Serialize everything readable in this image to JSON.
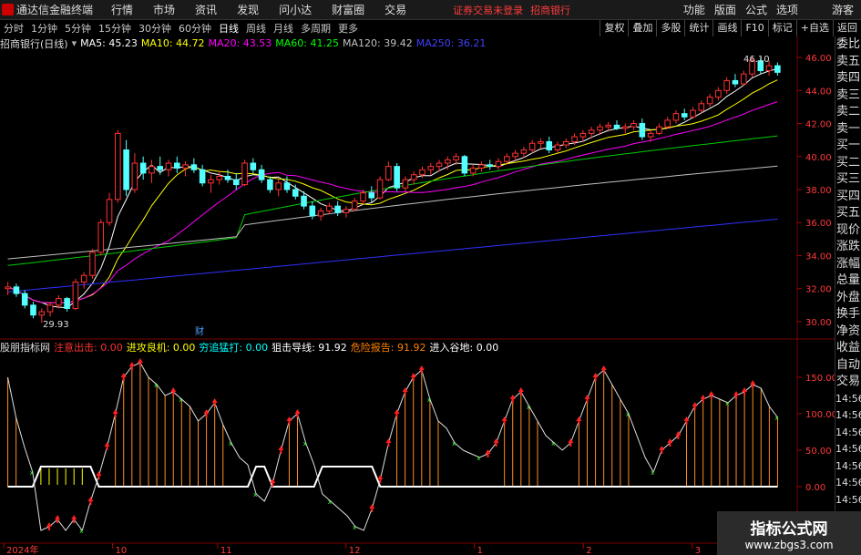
{
  "menubar": {
    "app_title": "通达信金融终端",
    "items": [
      "行情",
      "市场",
      "资讯",
      "发现",
      "问小达",
      "财富圈",
      "交易"
    ],
    "warning": "证券交易未登录",
    "broker": "招商银行",
    "right_items": [
      "功能",
      "版面",
      "公式",
      "选项"
    ],
    "guest": "游客"
  },
  "toolbar": {
    "periods": [
      "分时",
      "1分钟",
      "5分钟",
      "15分钟",
      "30分钟",
      "60分钟",
      "日线",
      "周线",
      "月线",
      "多周期",
      "更多"
    ],
    "active_period": "日线",
    "buttons": [
      "复权",
      "叠加",
      "多股",
      "统计",
      "画线",
      "F10",
      "标记",
      "+自选",
      "返回"
    ]
  },
  "stock": {
    "name": "招商银行(日线)"
  },
  "ma_legend": [
    {
      "label": "MA5: 45.23",
      "color": "#ffffff"
    },
    {
      "label": "MA10: 44.72",
      "color": "#ffff00"
    },
    {
      "label": "MA20: 43.53",
      "color": "#ff00ff"
    },
    {
      "label": "MA60: 41.25",
      "color": "#00ff00"
    },
    {
      "label": "MA120: 39.42",
      "color": "#c0c0c0"
    },
    {
      "label": "MA250: 36.21",
      "color": "#4040ff"
    }
  ],
  "indicator": {
    "name": "股朋指标网",
    "items": [
      {
        "label": "注意出击: 0.00",
        "color": "#ff3030"
      },
      {
        "label": "进攻良机: 0.00",
        "color": "#ffff00"
      },
      {
        "label": "穷追猛打: 0.00",
        "color": "#00ffff"
      },
      {
        "label": "狙击导线: 91.92",
        "color": "#ffffff"
      },
      {
        "label": "危险报告: 91.92",
        "color": "#ff8000"
      },
      {
        "label": "进入谷地: 0.00",
        "color": "#ffffff"
      }
    ]
  },
  "sidebar": [
    "委比",
    "卖五",
    "卖四",
    "卖三",
    "卖二",
    "卖一",
    "买一",
    "买二",
    "买三",
    "买四",
    "买五",
    "现价",
    "涨跌",
    "涨幅",
    "总量",
    "外盘",
    "换手",
    "净资",
    "收益",
    "自动",
    "交易",
    "14:56",
    "14:56",
    "14:56",
    "14:56",
    "14:56",
    "14:56",
    "14:56",
    "14:56"
  ],
  "price_axis": [
    "46.00",
    "44.00",
    "42.00",
    "40.00",
    "38.00",
    "36.00",
    "34.00",
    "32.00",
    "30.00"
  ],
  "ind_axis": [
    "150.00",
    "100.00",
    "50.00",
    "0.00"
  ],
  "time_axis": [
    "2024年",
    "10",
    "11",
    "12",
    "1",
    "2",
    "3"
  ],
  "annotations": {
    "high": "46.10",
    "low": "29.93",
    "cai": "财"
  },
  "watermark": {
    "line1": "指标公式网",
    "line2": "www.zbgs3.com"
  },
  "chart_data": {
    "type": "candlestick",
    "ylim": [
      29.5,
      46.5
    ],
    "candles": [
      [
        32.0,
        32.4,
        31.6,
        32.1
      ],
      [
        32.1,
        32.3,
        31.5,
        31.7
      ],
      [
        31.7,
        31.9,
        30.8,
        31.0
      ],
      [
        31.0,
        31.2,
        30.2,
        30.4
      ],
      [
        30.4,
        30.8,
        29.93,
        30.6
      ],
      [
        30.6,
        31.2,
        30.3,
        31.0
      ],
      [
        31.0,
        31.6,
        30.8,
        31.4
      ],
      [
        31.4,
        31.5,
        30.6,
        30.8
      ],
      [
        30.8,
        32.6,
        30.7,
        32.4
      ],
      [
        32.4,
        33.0,
        32.0,
        32.8
      ],
      [
        32.8,
        34.4,
        32.6,
        34.2
      ],
      [
        34.2,
        36.2,
        34.0,
        36.0
      ],
      [
        36.0,
        37.8,
        35.8,
        37.4
      ],
      [
        37.4,
        41.6,
        37.2,
        41.4
      ],
      [
        40.4,
        41.0,
        37.6,
        38.0
      ],
      [
        38.0,
        40.2,
        37.8,
        39.6
      ],
      [
        39.6,
        40.0,
        38.6,
        39.0
      ],
      [
        39.0,
        39.8,
        38.4,
        39.4
      ],
      [
        39.4,
        40.0,
        38.9,
        39.2
      ],
      [
        39.2,
        39.8,
        38.8,
        39.6
      ],
      [
        39.6,
        40.0,
        39.0,
        39.3
      ],
      [
        39.3,
        39.7,
        38.8,
        39.5
      ],
      [
        39.5,
        39.9,
        39.0,
        39.2
      ],
      [
        39.2,
        39.5,
        38.2,
        38.4
      ],
      [
        38.4,
        38.9,
        37.8,
        38.6
      ],
      [
        38.6,
        39.1,
        38.3,
        38.8
      ],
      [
        38.8,
        39.2,
        38.4,
        38.6
      ],
      [
        38.6,
        39.0,
        38.0,
        38.3
      ],
      [
        38.3,
        39.8,
        38.2,
        39.6
      ],
      [
        39.6,
        39.9,
        39.0,
        39.2
      ],
      [
        39.2,
        39.5,
        38.4,
        38.6
      ],
      [
        38.6,
        38.8,
        37.8,
        38.0
      ],
      [
        38.0,
        38.6,
        37.6,
        38.4
      ],
      [
        38.4,
        38.8,
        37.8,
        38.0
      ],
      [
        38.0,
        38.3,
        37.4,
        37.6
      ],
      [
        37.6,
        37.9,
        36.8,
        37.0
      ],
      [
        37.0,
        37.3,
        36.2,
        36.4
      ],
      [
        36.4,
        36.9,
        36.1,
        36.7
      ],
      [
        36.7,
        37.2,
        36.5,
        37.0
      ],
      [
        37.0,
        37.3,
        36.4,
        36.6
      ],
      [
        36.6,
        37.0,
        36.3,
        36.8
      ],
      [
        36.8,
        37.5,
        36.7,
        37.3
      ],
      [
        37.3,
        38.0,
        37.1,
        37.8
      ],
      [
        37.8,
        38.2,
        37.2,
        37.5
      ],
      [
        37.5,
        38.8,
        37.4,
        38.6
      ],
      [
        38.6,
        39.7,
        38.5,
        39.4
      ],
      [
        39.4,
        39.6,
        37.9,
        38.1
      ],
      [
        38.1,
        38.8,
        37.9,
        38.6
      ],
      [
        38.6,
        39.1,
        38.3,
        38.9
      ],
      [
        38.9,
        39.4,
        38.7,
        39.2
      ],
      [
        39.2,
        39.6,
        38.9,
        39.4
      ],
      [
        39.4,
        39.8,
        39.1,
        39.6
      ],
      [
        39.6,
        40.0,
        39.2,
        39.8
      ],
      [
        39.8,
        40.2,
        39.5,
        40.0
      ],
      [
        40.0,
        40.1,
        38.8,
        39.0
      ],
      [
        39.0,
        39.5,
        38.8,
        39.3
      ],
      [
        39.3,
        39.7,
        39.1,
        39.5
      ],
      [
        39.5,
        39.8,
        39.2,
        39.4
      ],
      [
        39.4,
        39.9,
        39.2,
        39.7
      ],
      [
        39.7,
        40.2,
        39.5,
        40.0
      ],
      [
        40.0,
        40.4,
        39.7,
        40.2
      ],
      [
        40.2,
        40.6,
        39.9,
        40.4
      ],
      [
        40.4,
        41.0,
        40.2,
        40.8
      ],
      [
        40.8,
        41.1,
        40.5,
        40.9
      ],
      [
        40.9,
        41.2,
        40.2,
        40.4
      ],
      [
        40.4,
        40.9,
        40.2,
        40.7
      ],
      [
        40.7,
        41.1,
        40.5,
        40.9
      ],
      [
        40.9,
        41.4,
        40.7,
        41.2
      ],
      [
        41.2,
        41.6,
        40.9,
        41.4
      ],
      [
        41.4,
        41.8,
        41.1,
        41.6
      ],
      [
        41.6,
        42.0,
        41.3,
        41.8
      ],
      [
        41.8,
        42.1,
        41.5,
        41.9
      ],
      [
        41.9,
        42.2,
        41.6,
        41.7
      ],
      [
        41.7,
        42.0,
        41.4,
        41.8
      ],
      [
        41.8,
        42.2,
        41.6,
        42.0
      ],
      [
        42.0,
        42.3,
        41.0,
        41.2
      ],
      [
        41.2,
        41.6,
        40.9,
        41.4
      ],
      [
        41.4,
        42.0,
        41.3,
        41.8
      ],
      [
        41.8,
        42.4,
        41.7,
        42.2
      ],
      [
        42.2,
        42.8,
        42.0,
        42.6
      ],
      [
        42.6,
        42.9,
        42.2,
        42.4
      ],
      [
        42.4,
        43.0,
        42.3,
        42.8
      ],
      [
        42.8,
        43.4,
        42.6,
        43.2
      ],
      [
        43.2,
        43.8,
        43.0,
        43.6
      ],
      [
        43.6,
        44.2,
        43.4,
        44.0
      ],
      [
        44.0,
        44.8,
        43.8,
        44.6
      ],
      [
        44.6,
        45.0,
        44.2,
        44.4
      ],
      [
        44.4,
        45.2,
        44.3,
        45.0
      ],
      [
        45.0,
        46.1,
        44.8,
        45.8
      ],
      [
        45.8,
        46.0,
        45.0,
        45.2
      ],
      [
        45.2,
        45.8,
        44.9,
        45.5
      ],
      [
        45.5,
        45.7,
        44.9,
        45.1
      ]
    ],
    "indicator_series": [
      150,
      95,
      55,
      20,
      -60,
      -55,
      -45,
      -60,
      -45,
      -60,
      -20,
      15,
      55,
      100,
      150,
      165,
      170,
      150,
      140,
      125,
      130,
      120,
      110,
      90,
      100,
      115,
      85,
      60,
      40,
      30,
      -10,
      -20,
      5,
      50,
      90,
      100,
      60,
      30,
      -10,
      -20,
      -30,
      -40,
      -55,
      -60,
      -30,
      10,
      60,
      100,
      130,
      150,
      160,
      120,
      90,
      80,
      60,
      50,
      45,
      40,
      45,
      60,
      90,
      120,
      130,
      110,
      90,
      70,
      60,
      50,
      60,
      90,
      120,
      150,
      160,
      140,
      120,
      100,
      70,
      40,
      20,
      50,
      60,
      70,
      90,
      110,
      120,
      125,
      120,
      115,
      125,
      130,
      140,
      135,
      110,
      95
    ],
    "ind_ylim": [
      -70,
      180
    ]
  }
}
